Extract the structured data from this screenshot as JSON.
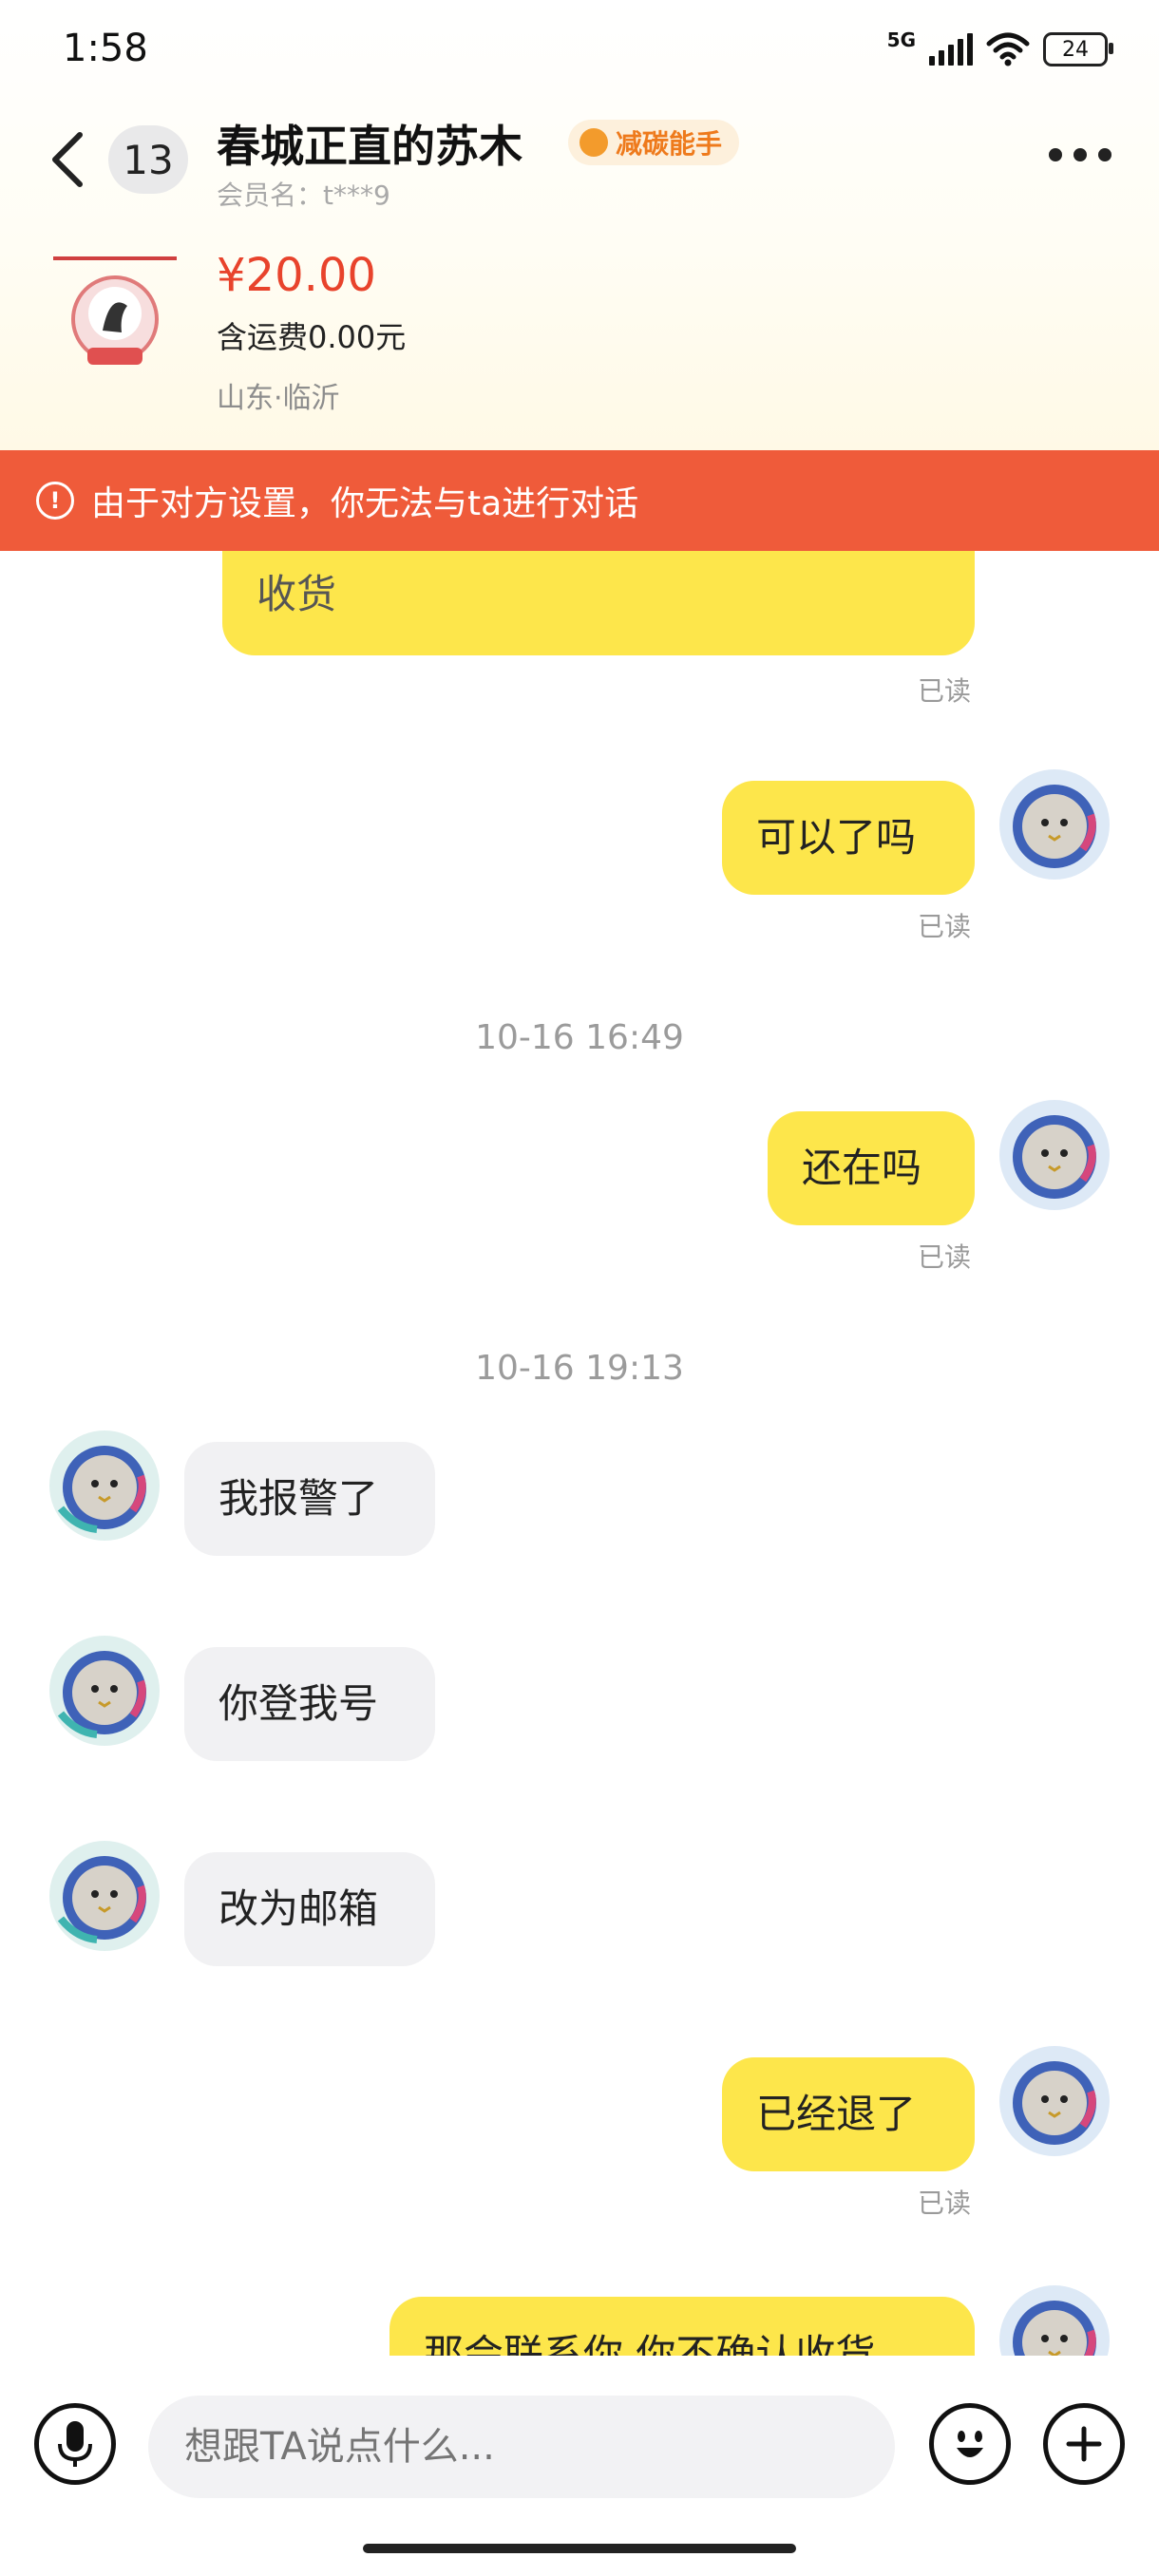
{
  "status": {
    "time": "1:58",
    "network": "5G",
    "battery": "24"
  },
  "header": {
    "unread_count": "13",
    "shop_name": "春城正直的苏木",
    "tag": "减碳能手",
    "member": "会员名：t***9"
  },
  "product": {
    "price": "¥20.00",
    "shipping": "含运费0.00元",
    "location": "山东·临沂"
  },
  "alert": {
    "text": "由于对方设置，你无法与ta进行对话"
  },
  "messages": {
    "m0": "收货",
    "m1": "可以了吗",
    "time1": "10-16 16:49",
    "m2": "还在吗",
    "time2": "10-16 19:13",
    "m3": "我报警了",
    "m4": "你登我号",
    "m5": "改为邮箱",
    "m6": "已经退了",
    "m7": "那会联系你 你不确认收货",
    "read": "已读"
  },
  "input": {
    "placeholder": "想跟TA说点什么..."
  },
  "colors": {
    "my_bubble": "#fde64b",
    "their_bubble": "#f1f1f3",
    "alert": "#ef5b3a",
    "price": "#e8432c"
  }
}
